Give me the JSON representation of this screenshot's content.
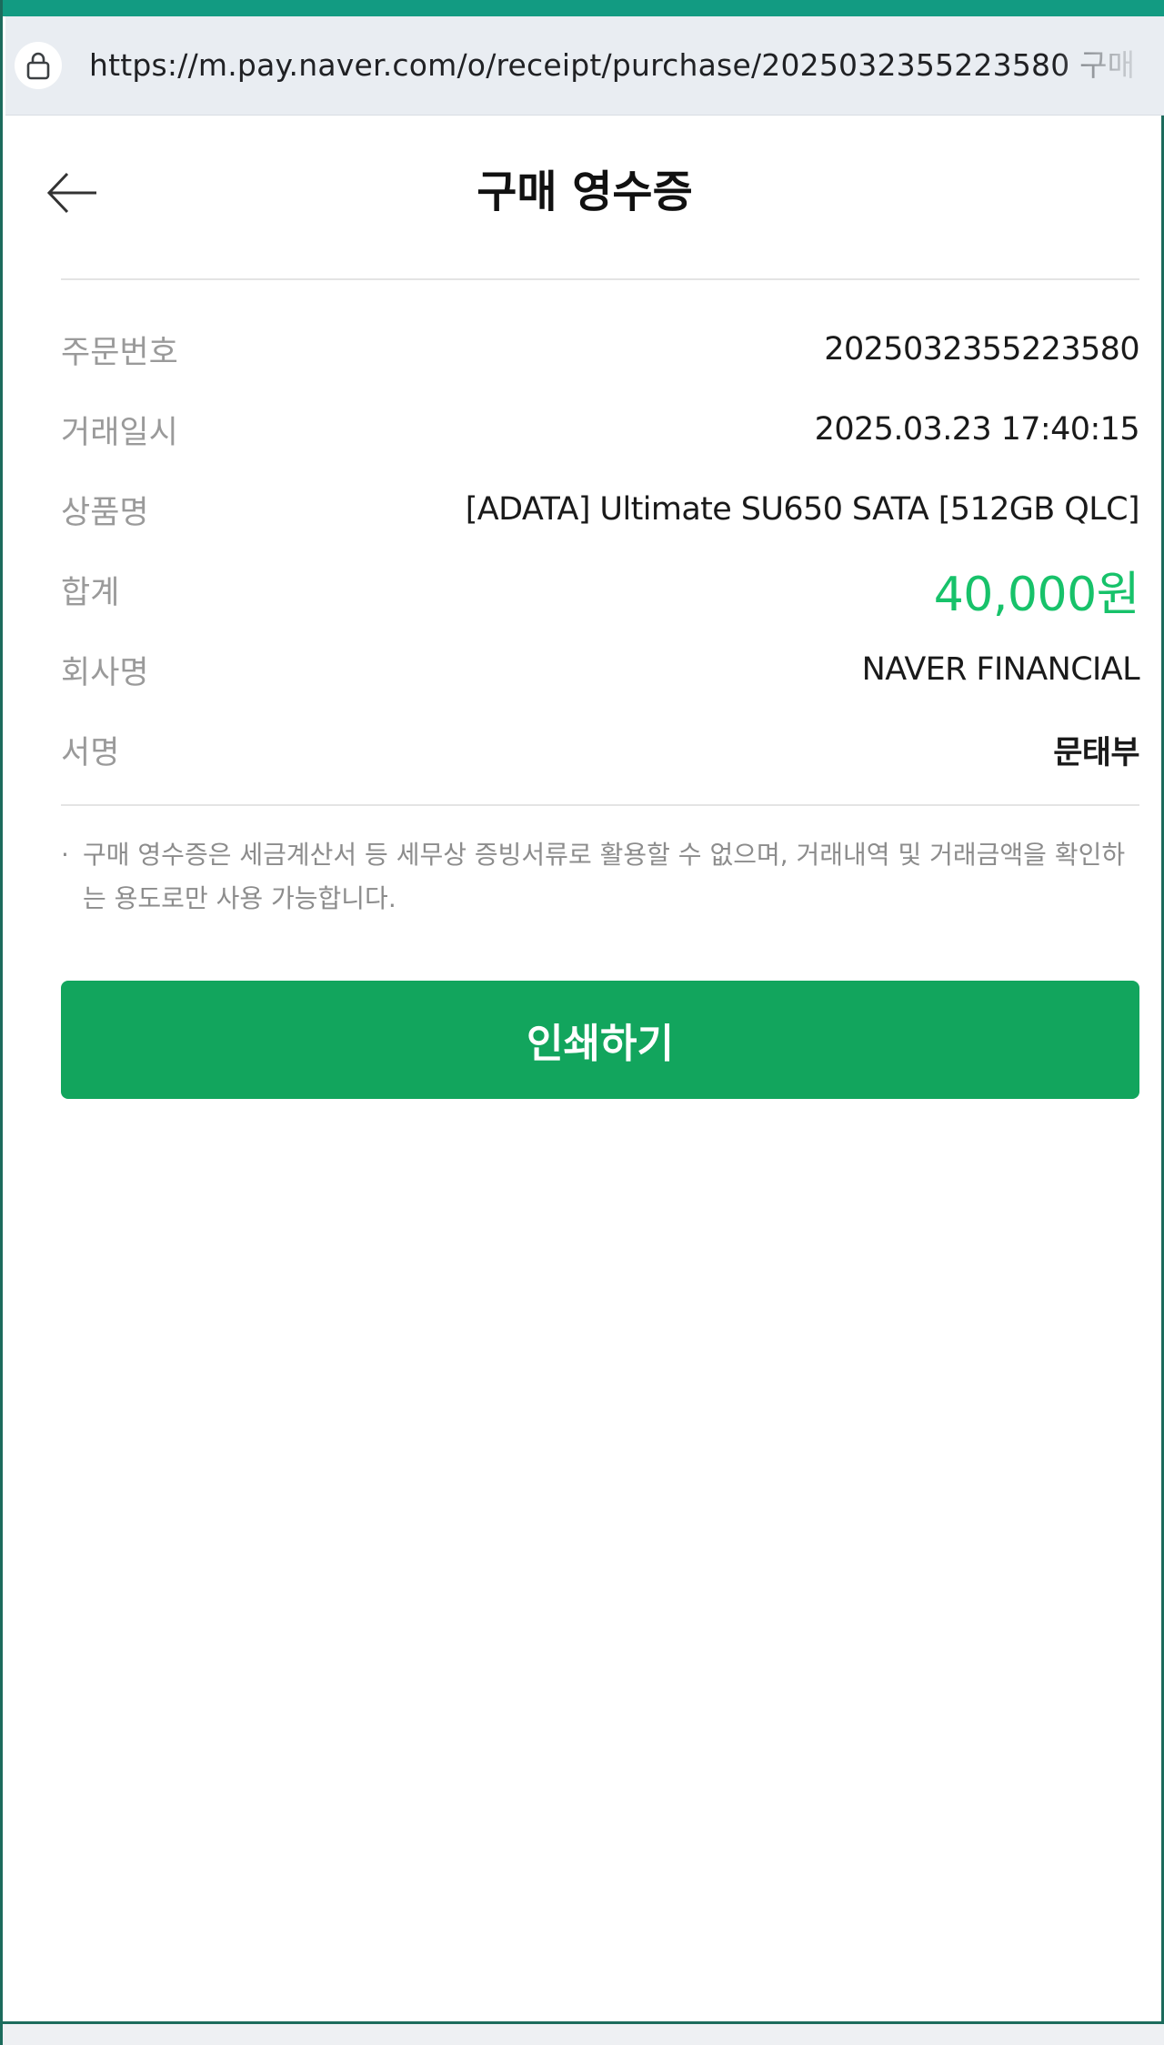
{
  "browser": {
    "url": "https://m.pay.naver.com/o/receipt/purchase/2025032355223580",
    "tab_title_fragment": "구매"
  },
  "header": {
    "title": "구매 영수증"
  },
  "receipt": {
    "order_number": {
      "label": "주문번호",
      "value": "2025032355223580"
    },
    "transaction_datetime": {
      "label": "거래일시",
      "value": "2025.03.23 17:40:15"
    },
    "product_name": {
      "label": "상품명",
      "value": "[ADATA] Ultimate SU650 SATA [512GB QLC]"
    },
    "total": {
      "label": "합계",
      "value": "40,000원"
    },
    "company": {
      "label": "회사명",
      "value": "NAVER FINANCIAL"
    },
    "signature": {
      "label": "서명",
      "value": "문태부"
    }
  },
  "notice": {
    "bullet": "·",
    "text": "구매 영수증은 세금계산서 등 세무상 증빙서류로 활용할 수 없으며, 거래내역 및 거래금액을 확인하는 용도로만 사용 가능합니다."
  },
  "actions": {
    "print_label": "인쇄하기"
  },
  "colors": {
    "accent_green": "#12a55d",
    "total_green": "#17c26a",
    "browser_top": "#129b82"
  },
  "icons": {
    "lock": "lock-icon",
    "back": "arrow-left-icon"
  }
}
